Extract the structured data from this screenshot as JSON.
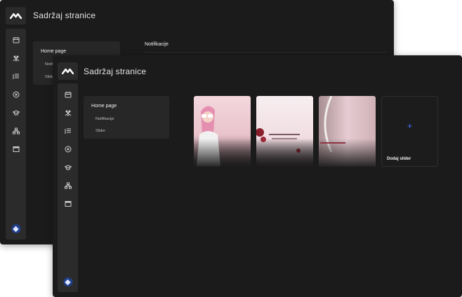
{
  "back_window": {
    "title": "Sadržaj stranice",
    "panel": {
      "heading": "Home page",
      "items": [
        "Notifikacije",
        "Slider"
      ]
    },
    "section_title": "Notifikacije"
  },
  "front_window": {
    "title": "Sadržaj stranice",
    "panel": {
      "heading": "Home page",
      "items": [
        "Notifikacije",
        "Slider"
      ]
    },
    "add_slider_label": "Dodaj slider",
    "add_icon": "+"
  },
  "sidebar_icons": [
    "calendar-icon",
    "users-icon",
    "list-icon",
    "circle-x-icon",
    "graduation-cap-icon",
    "sitemap-icon",
    "window-icon"
  ],
  "colors": {
    "background": "#1b1b1b",
    "surface": "#272727",
    "accent": "#3b6ef5",
    "avatar": "#1f3f8a"
  }
}
